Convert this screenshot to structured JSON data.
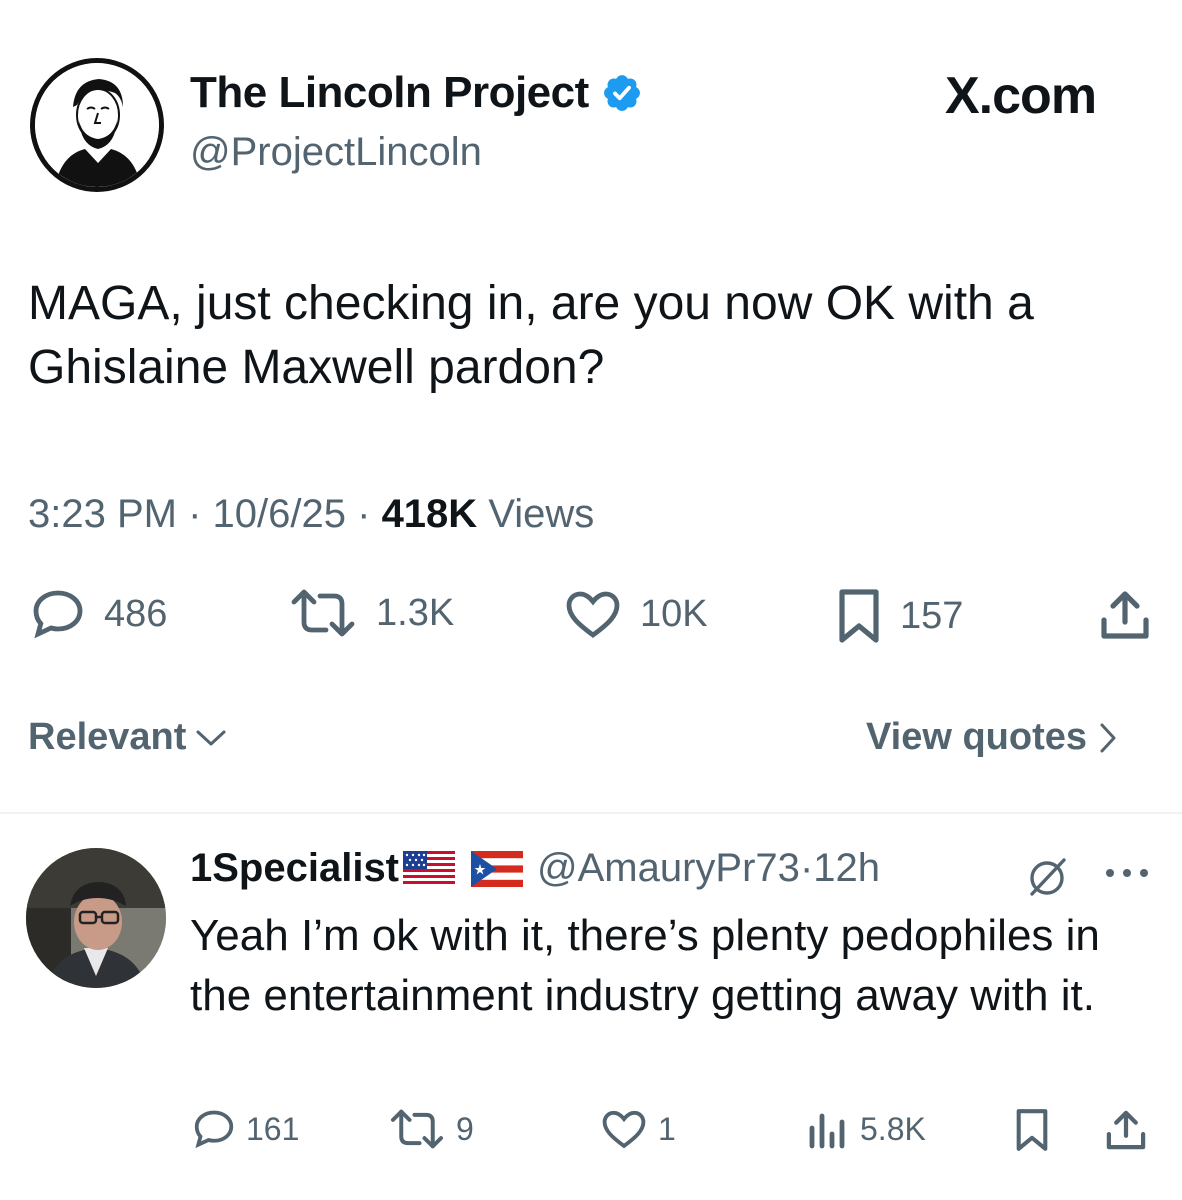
{
  "header": {
    "author_name": "The Lincoln Project",
    "handle": "@ProjectLincoln",
    "site_label": "X.com",
    "verified_color": "#1d9bf0"
  },
  "tweet": {
    "text": "MAGA, just checking in, are you now OK with a Ghislaine Maxwell pardon?",
    "time": "3:23 PM",
    "date": "10/6/25",
    "views_count": "418K",
    "views_label": "Views",
    "replies": "486",
    "reposts": "1.3K",
    "likes": "10K",
    "bookmarks": "157"
  },
  "sort": {
    "label": "Relevant",
    "view_quotes": "View quotes"
  },
  "reply": {
    "name": "1Specialist",
    "handle": "@AmauryPr73",
    "separator": "·",
    "time": "12h",
    "text": "Yeah I’m ok with it, there’s plenty pedophiles in the entertainment industry getting away with it.",
    "replies": "161",
    "reposts": "9",
    "likes": "1",
    "views": "5.8K"
  },
  "icons": {
    "avatar_main": "lincoln-portrait",
    "avatar_reply": "user-photo",
    "flags": [
      "us-flag",
      "puerto-rico-flag"
    ]
  }
}
